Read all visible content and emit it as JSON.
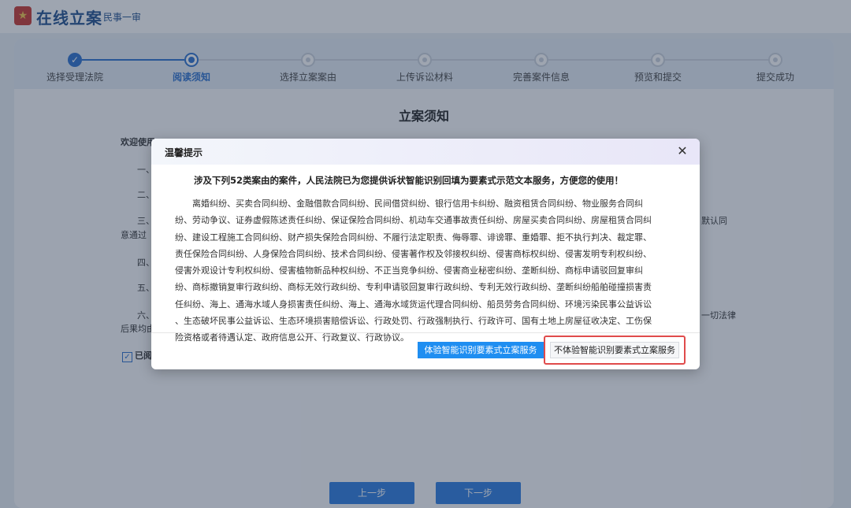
{
  "header": {
    "app_title": "在线立案",
    "case_type": "民事一审"
  },
  "steps": [
    {
      "label": "选择受理法院",
      "state": "done"
    },
    {
      "label": "阅读须知",
      "state": "active"
    },
    {
      "label": "选择立案案由",
      "state": "todo"
    },
    {
      "label": "上传诉讼材料",
      "state": "todo"
    },
    {
      "label": "完善案件信息",
      "state": "todo"
    },
    {
      "label": "预览和提交",
      "state": "todo"
    },
    {
      "label": "提交成功",
      "state": "todo"
    }
  ],
  "notice": {
    "title": "立案须知",
    "welcome": "欢迎使用",
    "items": [
      "一、",
      "二、",
      "三、",
      "四、",
      "五、",
      "六、"
    ],
    "fragment_agree_default": "默认同",
    "fragment_agree_passed": "意通过",
    "fragment_all_law": "一切法律",
    "fragment_consequence": "后果均由",
    "agree_label": "已阅"
  },
  "nav": {
    "prev_label": "上一步",
    "next_label": "下一步"
  },
  "modal": {
    "title": "温馨提示",
    "close_icon": "close-icon",
    "headline": "涉及下列52类案由的案件，人民法院已为您提供诉状智能识别回填为要素式示范文本服务，方便您的使用！",
    "body_lines": [
      "离婚纠纷、买卖合同纠纷、金融借款合同纠纷、民间借贷纠纷、银行信用卡纠纷、融资租赁合同纠纷、物业服务合同纠",
      "纷、劳动争议、证券虚假陈述责任纠纷、保证保险合同纠纷、机动车交通事故责任纠纷、房屋买卖合同纠纷、房屋租赁合同纠",
      "纷、建设工程施工合同纠纷、财产损失保险合同纠纷、不履行法定职责、侮辱罪、诽谤罪、重婚罪、拒不执行判决、裁定罪、",
      "责任保险合同纠纷、人身保险合同纠纷、技术合同纠纷、侵害著作权及邻接权纠纷、侵害商标权纠纷、侵害发明专利权纠纷、",
      "侵害外观设计专利权纠纷、侵害植物新品种权纠纷、不正当竞争纠纷、侵害商业秘密纠纷、垄断纠纷、商标申请驳回复审纠",
      "纷、商标撤销复审行政纠纷、商标无效行政纠纷、专利申请驳回复审行政纠纷、专利无效行政纠纷、垄断纠纷船舶碰撞损害责",
      "任纠纷、海上、通海水域人身损害责任纠纷、海上、通海水域货运代理合同纠纷、船员劳务合同纠纷、环境污染民事公益诉讼",
      "、生态破坏民事公益诉讼、生态环境损害赔偿诉讼、行政处罚、行政强制执行、行政许可、国有土地上房屋征收决定、工伤保",
      "险资格或者待遇认定、政府信息公开、行政复议、行政协议。"
    ],
    "btn_experience": "体验智能识别要素式立案服务",
    "btn_no_experience": "不体验智能识别要素式立案服务",
    "highlight_color": "#e04b4b",
    "primary_color": "#1f8ef1"
  }
}
